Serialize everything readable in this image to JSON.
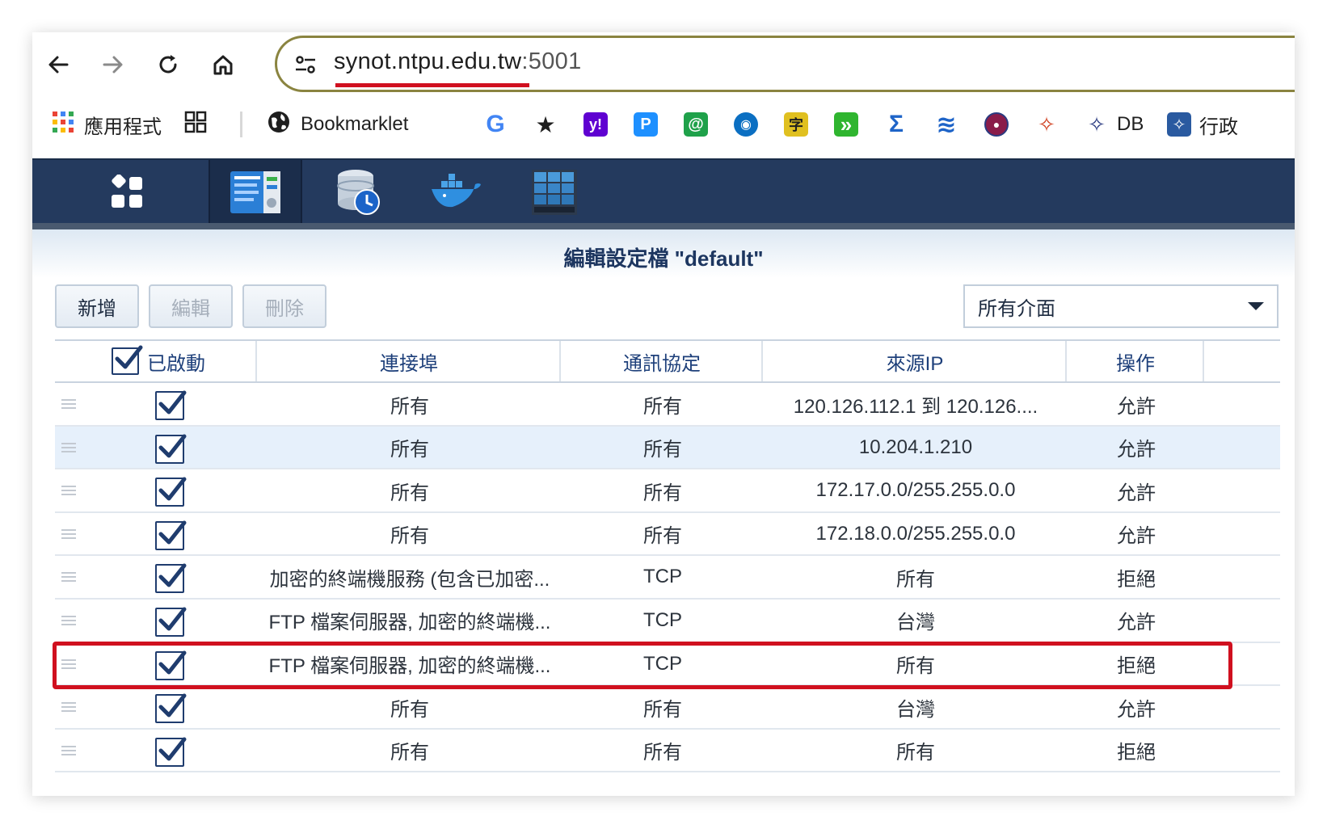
{
  "browser": {
    "url_host": "synot.ntpu.edu.tw",
    "url_port": ":5001"
  },
  "bookmarks": [
    {
      "label": "應用程式",
      "icon": "apps-grid-icon"
    },
    {
      "label": "",
      "icon": "tab-groups-icon"
    },
    {
      "label": "Bookmarklet",
      "icon": "globe-icon"
    },
    {
      "label": "",
      "icon": "google-icon",
      "glyph": "G",
      "color": "#4285f4"
    },
    {
      "label": "",
      "icon": "star-icon",
      "glyph": "★",
      "color": "#1f1f1f"
    },
    {
      "label": "",
      "icon": "yahoo-icon",
      "glyph": "y!",
      "color": "#5f01d1"
    },
    {
      "label": "",
      "icon": "p-icon",
      "glyph": "P",
      "color": "#1e90ff"
    },
    {
      "label": "",
      "icon": "green-icon",
      "glyph": "@",
      "color": "#1fa14a"
    },
    {
      "label": "",
      "icon": "eye-icon",
      "glyph": "◉",
      "color": "#0b6fc2"
    },
    {
      "label": "",
      "icon": "dictionary-icon",
      "glyph": "字",
      "color": "#e0c020"
    },
    {
      "label": "",
      "icon": "forward-icon",
      "glyph": "»",
      "color": "#2fb52f"
    },
    {
      "label": "",
      "icon": "sigma-icon",
      "glyph": "Σ",
      "color": "#1e64c8"
    },
    {
      "label": "",
      "icon": "stack-icon",
      "glyph": "≋",
      "color": "#1e64c8"
    },
    {
      "label": "",
      "icon": "seal-icon",
      "glyph": "●",
      "color": "#8a1c4a"
    },
    {
      "label": "",
      "icon": "ntpu-icon",
      "glyph": "✧",
      "color": "#d04020"
    },
    {
      "label": "DB",
      "icon": "ntpu-db-icon",
      "glyph": "✧",
      "color": "#2a3a80"
    },
    {
      "label": "行政",
      "icon": "ntpu-admin-icon",
      "glyph": "✧",
      "color": "#2a5aa0"
    }
  ],
  "window": {
    "title": "編輯設定檔 \"default\""
  },
  "toolbar": {
    "add_label": "新增",
    "edit_label": "編輯",
    "delete_label": "刪除",
    "interface_value": "所有介面"
  },
  "table": {
    "headers": {
      "enabled": "已啟動",
      "port": "連接埠",
      "protocol": "通訊協定",
      "source_ip": "來源IP",
      "action": "操作"
    },
    "rows": [
      {
        "enabled": true,
        "port": "所有",
        "protocol": "所有",
        "source_ip": "120.126.112.1 到 120.126....",
        "action": "允許"
      },
      {
        "enabled": true,
        "port": "所有",
        "protocol": "所有",
        "source_ip": "10.204.1.210",
        "action": "允許"
      },
      {
        "enabled": true,
        "port": "所有",
        "protocol": "所有",
        "source_ip": "172.17.0.0/255.255.0.0",
        "action": "允許"
      },
      {
        "enabled": true,
        "port": "所有",
        "protocol": "所有",
        "source_ip": "172.18.0.0/255.255.0.0",
        "action": "允許"
      },
      {
        "enabled": true,
        "port": "加密的終端機服務 (包含已加密...",
        "protocol": "TCP",
        "source_ip": "所有",
        "action": "拒絕"
      },
      {
        "enabled": true,
        "port": "FTP 檔案伺服器, 加密的終端機...",
        "protocol": "TCP",
        "source_ip": "台灣",
        "action": "允許"
      },
      {
        "enabled": true,
        "port": "FTP 檔案伺服器, 加密的終端機...",
        "protocol": "TCP",
        "source_ip": "所有",
        "action": "拒絕"
      },
      {
        "enabled": true,
        "port": "所有",
        "protocol": "所有",
        "source_ip": "台灣",
        "action": "允許"
      },
      {
        "enabled": true,
        "port": "所有",
        "protocol": "所有",
        "source_ip": "所有",
        "action": "拒絕"
      }
    ],
    "selected_row": 1
  }
}
